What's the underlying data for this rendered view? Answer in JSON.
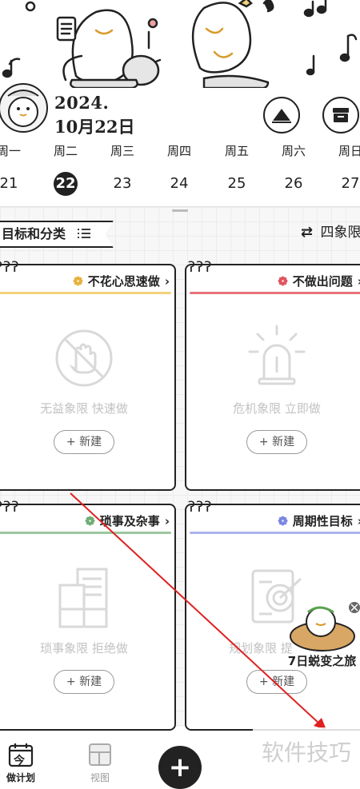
{
  "header": {
    "year": "2024.",
    "month_day": "10月22日",
    "buttons": [
      {
        "icon": "mountain-icon"
      },
      {
        "icon": "archive-box-icon"
      }
    ]
  },
  "week": {
    "days": [
      {
        "label": "周一",
        "num": "21",
        "selected": false
      },
      {
        "label": "周二",
        "num": "22",
        "selected": true
      },
      {
        "label": "周三",
        "num": "23",
        "selected": false
      },
      {
        "label": "周四",
        "num": "24",
        "selected": false
      },
      {
        "label": "周五",
        "num": "25",
        "selected": false
      },
      {
        "label": "周六",
        "num": "26",
        "selected": false
      },
      {
        "label": "周日",
        "num": "27",
        "selected": false
      }
    ]
  },
  "category_tag": "目标和分类",
  "quadrant_switch": "四象限",
  "quadrants": [
    {
      "title": "不花心思速做",
      "bar_color": "#f2d27a",
      "flower_color": "#e6b23c",
      "empty_text": "无益象限 快速做",
      "new_label": "+ 新建",
      "icon": "hand-stop-icon"
    },
    {
      "title": "不做出问题",
      "bar_color": "#e9727a",
      "flower_color": "#e05560",
      "empty_text": "危机象限 立即做",
      "new_label": "+ 新建",
      "icon": "alarm-light-icon"
    },
    {
      "title": "琐事及杂事",
      "bar_color": "#9cc79f",
      "flower_color": "#6fae76",
      "empty_text": "琐事象限 拒绝做",
      "new_label": "+ 新建",
      "icon": "documents-icon"
    },
    {
      "title": "周期性目标",
      "bar_color": "#a9b3ee",
      "flower_color": "#7b86e3",
      "empty_text": "规划象限 提",
      "new_label": "+ 新建",
      "icon": "target-scroll-icon"
    }
  ],
  "nav": {
    "items": [
      {
        "label": "做计划",
        "icon": "calendar-today-icon",
        "icon_text": "今"
      },
      {
        "label": "视图",
        "icon": "layout-icon"
      }
    ]
  },
  "promo": {
    "text": "7日蜕变之旅"
  },
  "watermark": "软件技巧"
}
